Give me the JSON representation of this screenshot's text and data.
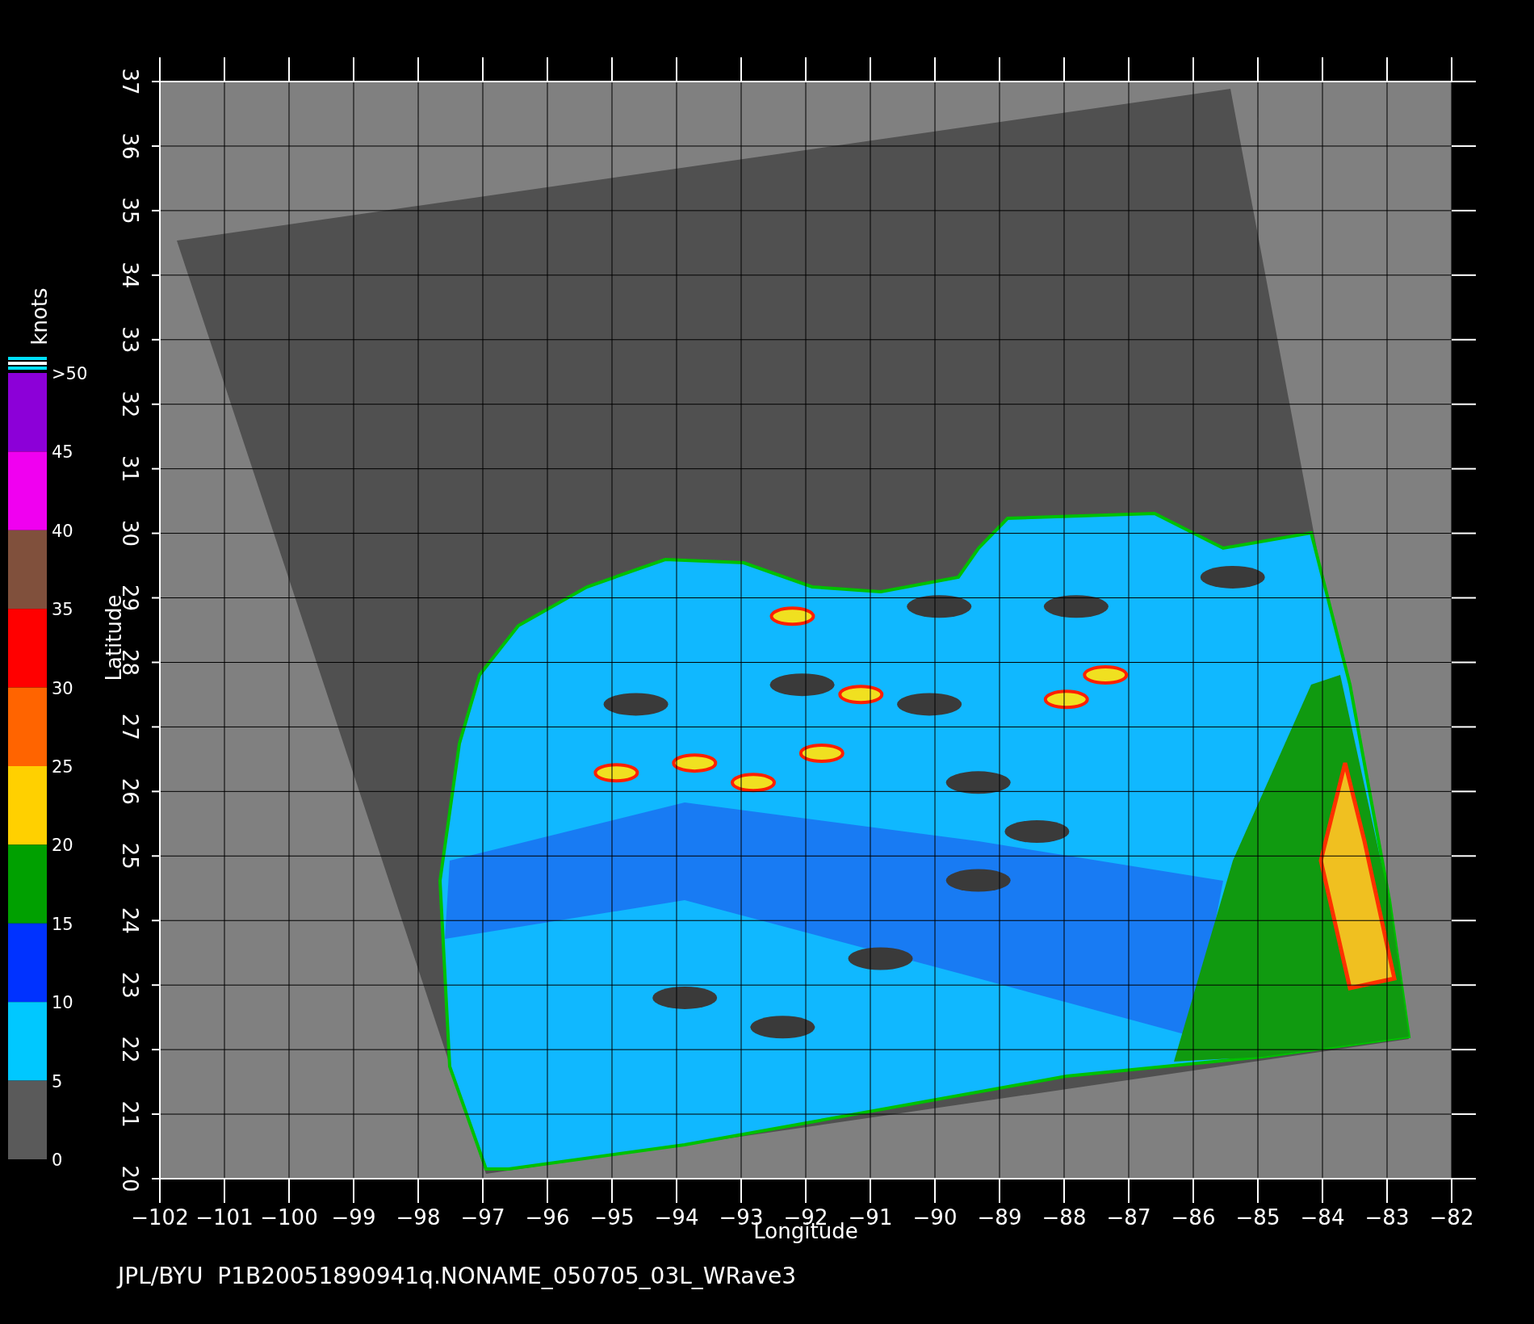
{
  "plot": {
    "xlabel": "Longitude",
    "ylabel": "Latitude",
    "xtick_labels": [
      "−102",
      "−101",
      "−100",
      "−99",
      "−98",
      "−97",
      "−96",
      "−95",
      "−94",
      "−93",
      "−92",
      "−91",
      "−90",
      "−89",
      "−88",
      "−87",
      "−86",
      "−85",
      "−84",
      "−83",
      "−82"
    ],
    "ytick_labels": [
      "20",
      "21",
      "22",
      "23",
      "24",
      "25",
      "26",
      "27",
      "28",
      "29",
      "30",
      "31",
      "32",
      "33",
      "34",
      "35",
      "36",
      "37"
    ]
  },
  "colorbar": {
    "unit": "knots",
    "top_label": ">50",
    "bands": [
      {
        "label": "45",
        "color": "#8c00d8"
      },
      {
        "label": "40",
        "color": "#f000f0"
      },
      {
        "label": "35",
        "color": "#80503c"
      },
      {
        "label": "30",
        "color": "#ff0000"
      },
      {
        "label": "25",
        "color": "#ff6400"
      },
      {
        "label": "20",
        "color": "#ffd000"
      },
      {
        "label": "15",
        "color": "#00a000"
      },
      {
        "label": "10",
        "color": "#0032ff"
      },
      {
        "label": "5",
        "color": "#00c8ff"
      },
      {
        "label": "0",
        "color": "#5a5a5a"
      }
    ]
  },
  "footer": "JPL/BYU  P1B20051890941q.NONAME_050705_03L_WRave3"
}
